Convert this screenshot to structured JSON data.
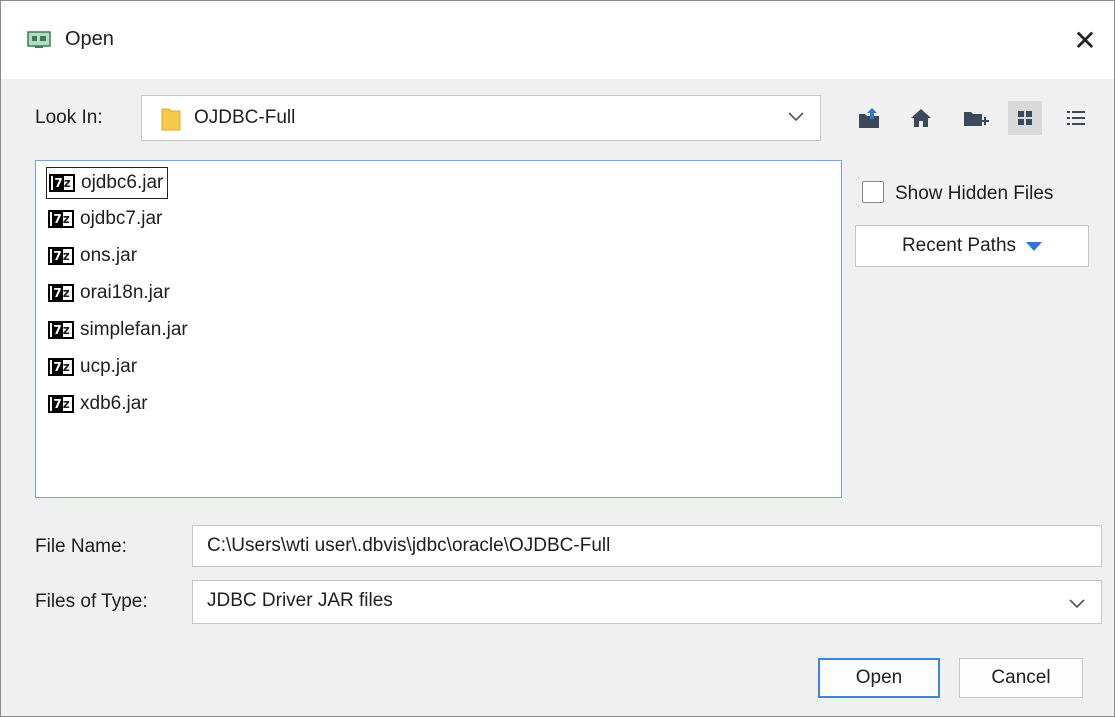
{
  "window": {
    "title": "Open",
    "close_glyph": "✕"
  },
  "look_in": {
    "label": "Look In:",
    "value": "OJDBC-Full"
  },
  "toolbar": {
    "icons": [
      "up-folder-icon",
      "home-icon",
      "new-folder-icon",
      "list-view-icon",
      "details-view-icon"
    ]
  },
  "files": [
    {
      "name": "ojdbc6.jar",
      "focused": true
    },
    {
      "name": "ojdbc7.jar",
      "focused": false
    },
    {
      "name": "ons.jar",
      "focused": false
    },
    {
      "name": "orai18n.jar",
      "focused": false
    },
    {
      "name": "simplefan.jar",
      "focused": false
    },
    {
      "name": "ucp.jar",
      "focused": false
    },
    {
      "name": "xdb6.jar",
      "focused": false
    }
  ],
  "options": {
    "show_hidden_label": "Show Hidden Files",
    "show_hidden_checked": false,
    "recent_paths_label": "Recent Paths"
  },
  "file_name": {
    "label": "File Name:",
    "value": "C:\\Users\\wti user\\.dbvis\\jdbc\\oracle\\OJDBC-Full"
  },
  "file_type": {
    "label": "Files of Type:",
    "value": "JDBC Driver JAR files"
  },
  "buttons": {
    "open_label": "Open",
    "cancel_label": "Cancel"
  },
  "colors": {
    "accent": "#3c86d8",
    "dropdown_triangle": "#2f7ad1",
    "folder": "#f7c948"
  }
}
